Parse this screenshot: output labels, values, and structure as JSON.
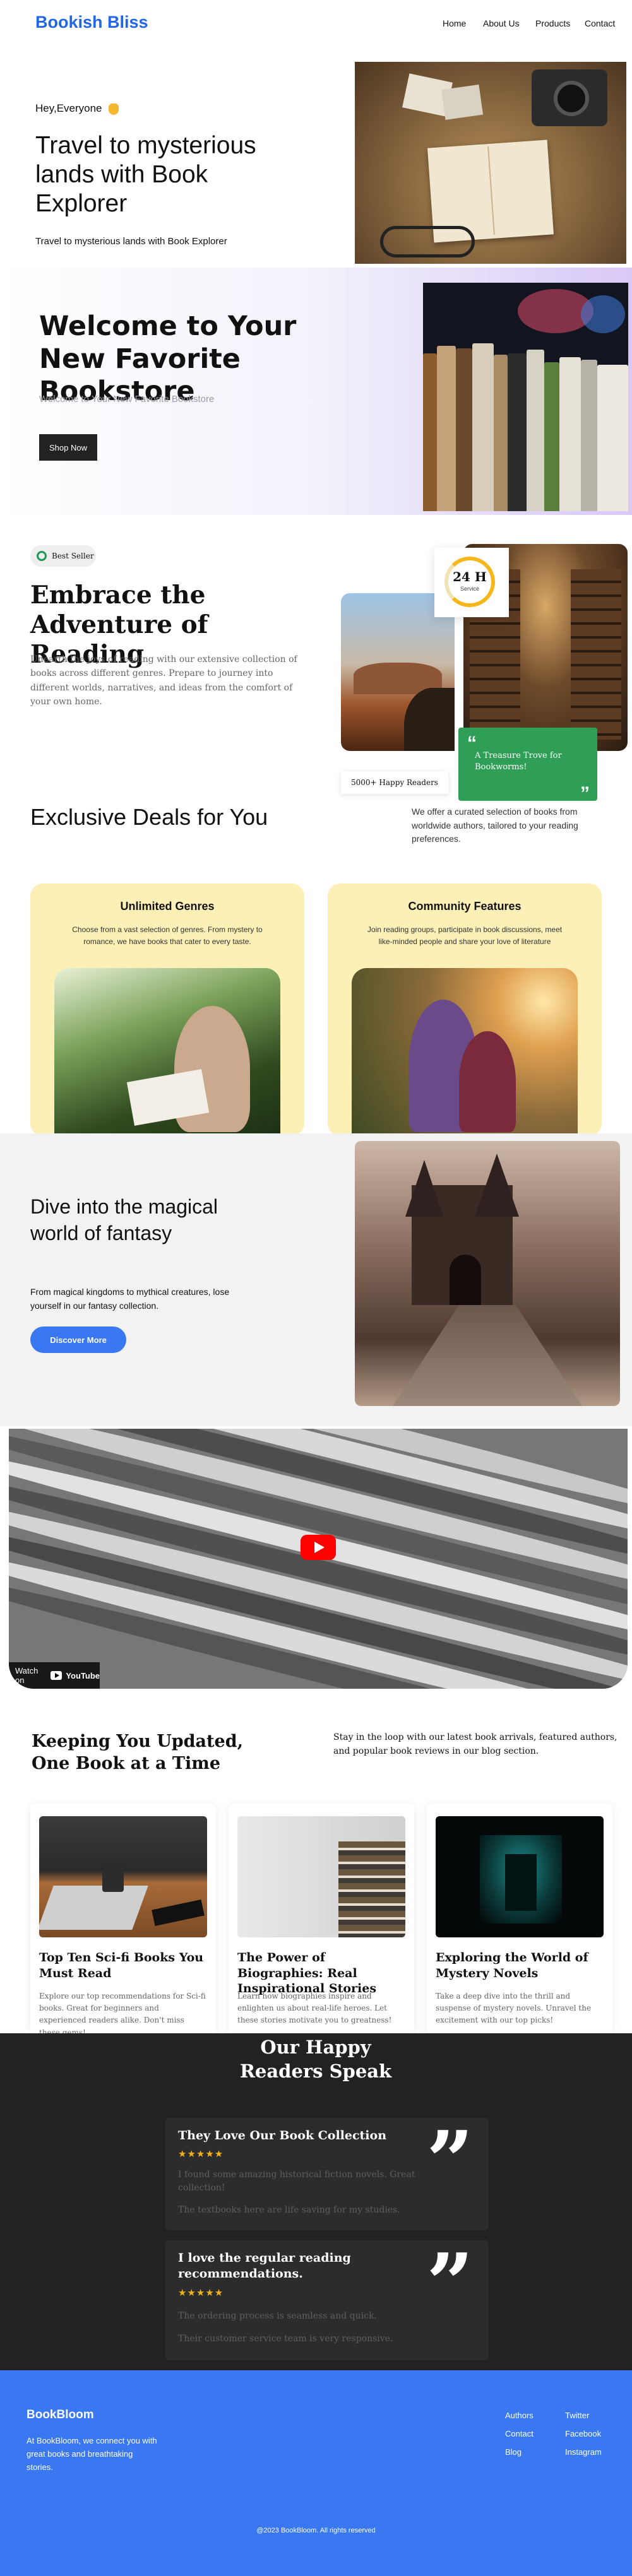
{
  "nav": {
    "brand": "Bookish Bliss",
    "links": [
      "Home",
      "About Us",
      "Products",
      "Contact"
    ]
  },
  "hero1": {
    "greeting": "Hey,Everyone",
    "title": "Travel to mysterious lands with Book Explorer",
    "subtitle": "Travel to mysterious lands with Book Explorer"
  },
  "hero2": {
    "title": "Welcome to Your New Favorite Bookstore",
    "subtitle": "Welcome to Your New Favorite Bookstore",
    "button": "Shop Now"
  },
  "embrace": {
    "badge": "Best Seller",
    "title": "Embrace the Adventure of Reading",
    "text": "Unearth the joys of reading with our extensive collection of books across different genres. Prepare to journey into different worlds, narratives, and ideas from the comfort of your own home.",
    "rating_value": "24 H",
    "rating_label": "Service",
    "green_card_text": "A Treasure Trove for Bookworms!",
    "readers": "5000+ Happy Readers"
  },
  "deals": {
    "title": "Exclusive Deals for You",
    "text": "We offer a curated selection of books from worldwide authors, tailored to your reading preferences.",
    "cards": [
      {
        "title": "Unlimited Genres",
        "text": "Choose from a vast selection of genres. From mystery to romance, we have books that cater to every taste."
      },
      {
        "title": "Community Features",
        "text": "Join reading groups, participate in book discussions, meet like-minded people and share your love of literature"
      }
    ]
  },
  "fantasy": {
    "title": "Dive into the magical world of fantasy",
    "text": "From magical kingdoms to mythical creatures, lose yourself in our fantasy collection.",
    "button": "Discover More"
  },
  "video": {
    "watch_on": "Watch on",
    "platform": "YouTube"
  },
  "blog": {
    "title": "Keeping You Updated, One Book at a Time",
    "intro": "Stay in the loop with our latest book arrivals, featured authors, and popular book reviews in our blog section.",
    "posts": [
      {
        "title": "Top Ten Sci-fi Books You Must Read",
        "text": "Explore our top recommendations for Sci-fi books. Great for beginners and experienced readers alike. Don't miss these gems!"
      },
      {
        "title": "The Power of Biographies: Real Inspirational Stories",
        "text": "Learn how biographies inspire and enlighten us about real-life heroes. Let these stories motivate you to greatness!"
      },
      {
        "title": "Exploring the World of Mystery Novels",
        "text": "Take a deep dive into the thrill and suspense of mystery novels. Unravel the excitement with our top picks!"
      }
    ]
  },
  "testimonials": {
    "title": "Our Happy Readers Speak",
    "items": [
      {
        "title": "They Love Our Book Collection",
        "stars": "★★★★★",
        "line1": "I found some amazing historical fiction novels. Great collection!",
        "line2": "The textbooks here are life saving for my studies."
      },
      {
        "title": "I love the regular reading recommendations.",
        "stars": "★★★★★",
        "line1": "The ordering process is seamless and quick.",
        "line2": "Their customer service team is very responsive."
      }
    ],
    "quote_mark": "”"
  },
  "footer": {
    "brand": "BookBloom",
    "description": "At BookBloom, we connect you with great books and breathtaking stories.",
    "col1": [
      "Authors",
      "Contact",
      "Blog"
    ],
    "col2": [
      "Twitter",
      "Facebook",
      "Instagram"
    ],
    "copyright": "@2023 BookBloom. All rights reserved"
  },
  "colors": {
    "brand": "#2266e3",
    "accent": "#3a78f2",
    "deal_card": "#fdf0b7",
    "green": "#2f9e57",
    "dark": "#222222"
  }
}
